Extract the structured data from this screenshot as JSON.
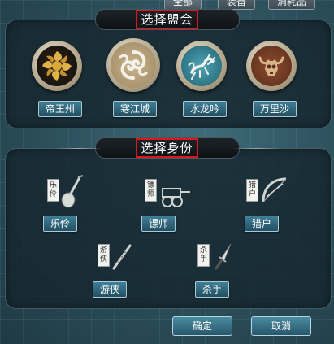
{
  "tabs": [
    "全部",
    "装备",
    "消耗品"
  ],
  "alliance_panel": {
    "title": "选择盟会",
    "alliances": [
      {
        "name": "帝王州",
        "icon": "golden-swirl-emblem-icon"
      },
      {
        "name": "寒江城",
        "icon": "white-cloud-swirl-emblem-icon"
      },
      {
        "name": "水龙吟",
        "icon": "blue-dragon-emblem-icon"
      },
      {
        "name": "万里沙",
        "icon": "ox-skull-emblem-icon"
      }
    ]
  },
  "identity_panel": {
    "title": "选择身份",
    "identities": [
      {
        "name": "乐伶",
        "tag": "乐伶",
        "icon": "pipa-icon"
      },
      {
        "name": "镖师",
        "tag": "镖师",
        "icon": "cart-icon"
      },
      {
        "name": "猎户",
        "tag": "猎户",
        "icon": "bow-icon"
      },
      {
        "name": "游侠",
        "tag": "游侠",
        "icon": "flute-icon"
      },
      {
        "name": "杀手",
        "tag": "杀手",
        "icon": "dagger-icon"
      }
    ]
  },
  "buttons": {
    "confirm": "确定",
    "cancel": "取消"
  },
  "colors": {
    "highlight_border": "#e0161c",
    "button": "#2f6a80"
  }
}
